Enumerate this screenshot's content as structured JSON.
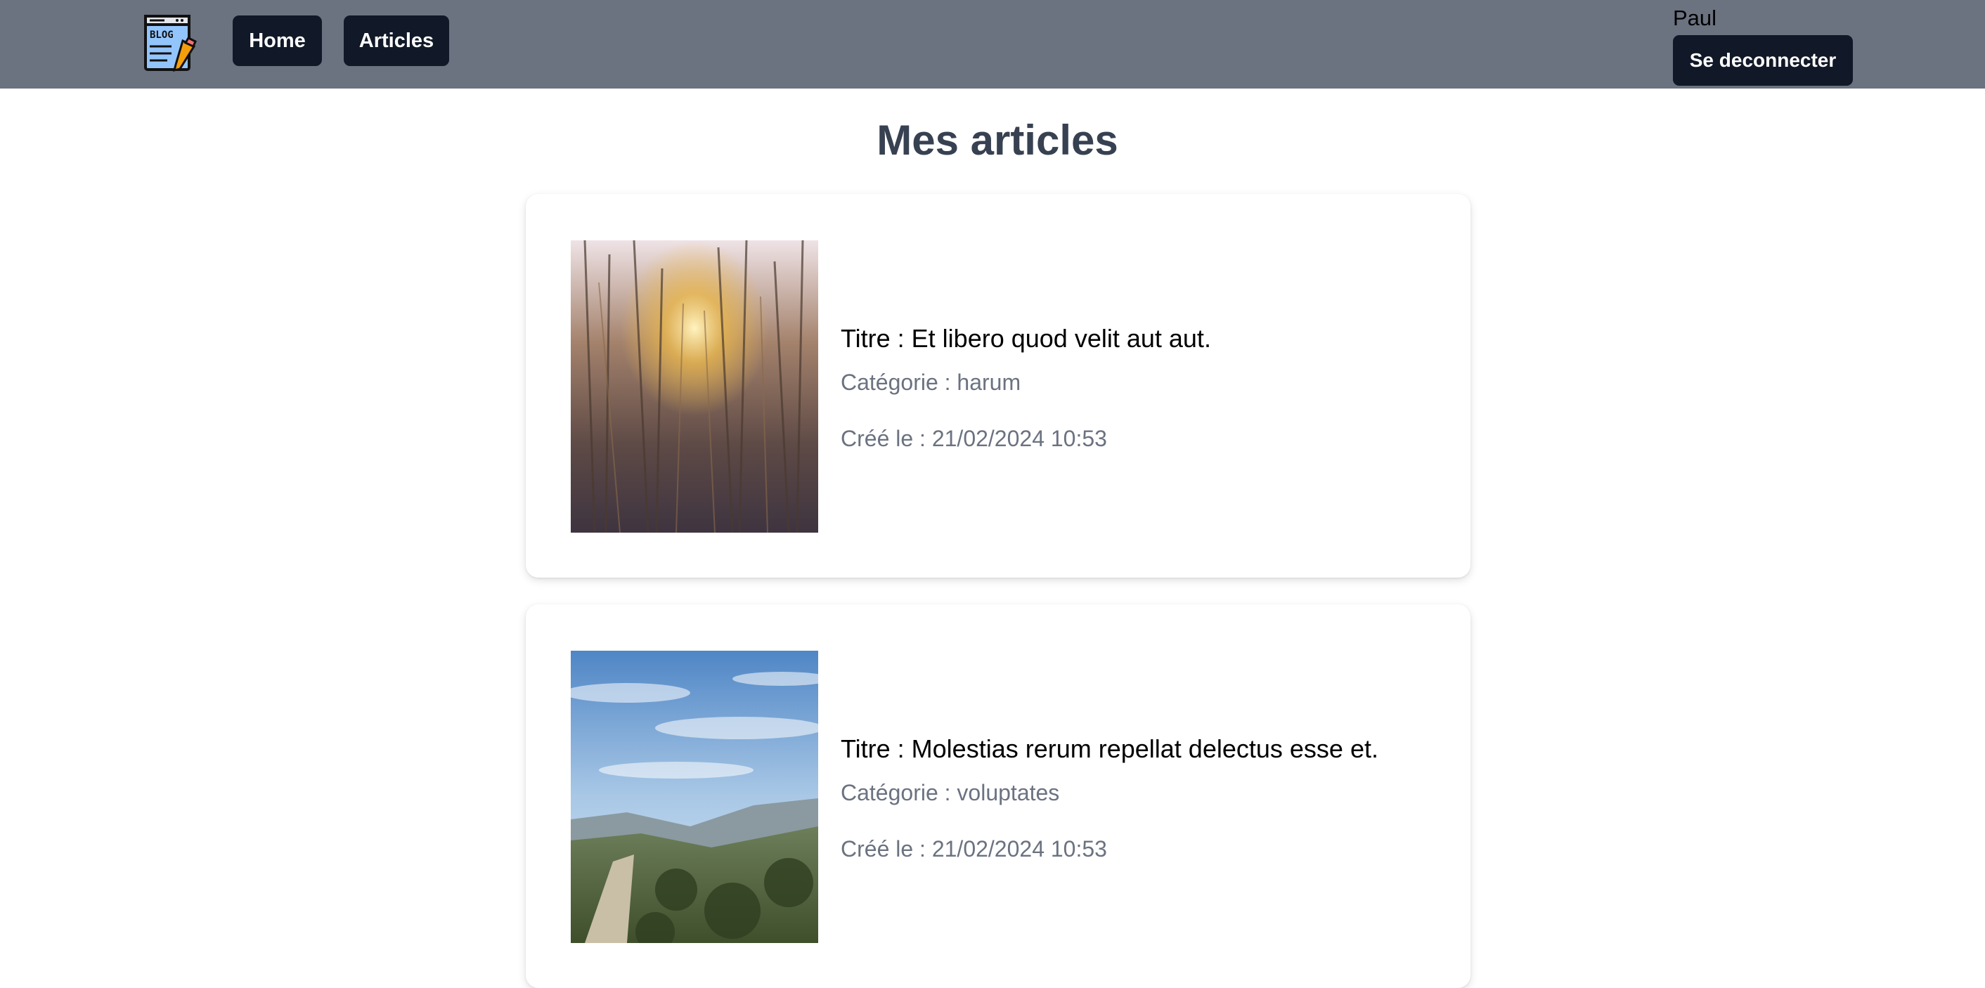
{
  "app": {
    "logo_text": "BLOG"
  },
  "nav": {
    "home_label": "Home",
    "articles_label": "Articles"
  },
  "user": {
    "name": "Paul",
    "logout_label": "Se deconnecter"
  },
  "page": {
    "title": "Mes articles"
  },
  "articles": [
    {
      "title": "Titre : Et libero quod velit aut aut.",
      "category": "Catégorie : harum",
      "created": "Créé le : 21/02/2024 10:53"
    },
    {
      "title": "Titre : Molestias rerum repellat delectus esse et.",
      "category": "Catégorie : voluptates",
      "created": "Créé le : 21/02/2024 10:53"
    }
  ],
  "colors": {
    "navbar": "#6b7280",
    "button": "#111827",
    "title": "#374151",
    "muted": "#6b7280"
  }
}
